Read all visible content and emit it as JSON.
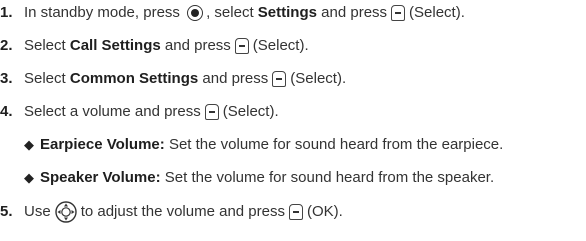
{
  "steps": [
    {
      "num": "1.",
      "a": "In standby mode, press",
      "b": ", select",
      "bold": "Settings",
      "c": "and press",
      "d": "(Select)."
    },
    {
      "num": "2.",
      "a": "Select",
      "bold": "Call Settings",
      "c": "and press",
      "d": "(Select)."
    },
    {
      "num": "3.",
      "a": "Select",
      "bold": "Common Settings",
      "c": "and press",
      "d": "(Select)."
    },
    {
      "num": "4.",
      "a": "Select a volume and press",
      "d": "(Select)."
    },
    {
      "num": "5.",
      "a": "Use",
      "b": "to adjust the volume and press",
      "d": "(OK)."
    }
  ],
  "bullets": [
    {
      "bold": "Earpiece Volume:",
      "text": "Set the volume for sound heard from the earpiece."
    },
    {
      "bold": "Speaker Volume:",
      "text": "Set the volume for sound heard from the speaker."
    }
  ],
  "icons": {
    "center_key": "center-key-icon",
    "soft_key": "left-soft-key-icon",
    "nav_key": "navigation-key-icon",
    "bullet": "diamond-bullet-icon"
  }
}
